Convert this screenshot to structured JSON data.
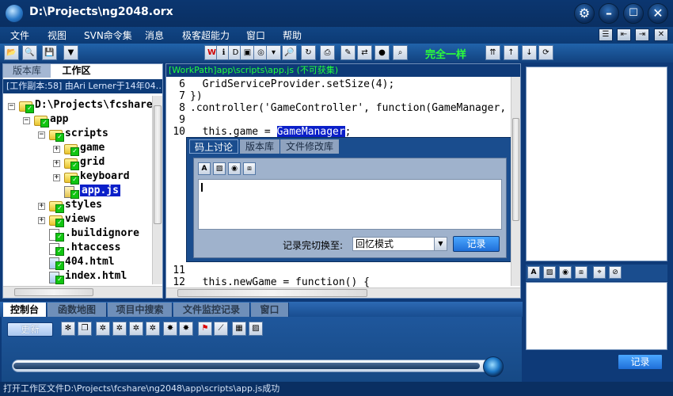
{
  "title": "D:\\Projects\\ng2048.orx",
  "menu": [
    "文件",
    "视图",
    "SVN命令集",
    "消息",
    "极客超能力",
    "窗口",
    "帮助"
  ],
  "toolbar": {
    "sync_status": "完全一样"
  },
  "left_panel": {
    "tabs": [
      "版本库",
      "工作区"
    ],
    "active_tab": "工作区",
    "workspace_info": "[工作副本:58] 由Ari Lerner于14年04…",
    "tree": [
      {
        "label": "D:\\Projects\\fcshare",
        "type": "folder",
        "expander": "−",
        "depth": 0
      },
      {
        "label": "app",
        "type": "folder",
        "expander": "−",
        "depth": 1
      },
      {
        "label": "scripts",
        "type": "folder",
        "expander": "−",
        "depth": 2
      },
      {
        "label": "game",
        "type": "folder",
        "expander": "+",
        "depth": 3
      },
      {
        "label": "grid",
        "type": "folder",
        "expander": "+",
        "depth": 3
      },
      {
        "label": "keyboard",
        "type": "folder",
        "expander": "+",
        "depth": 3
      },
      {
        "label": "app.js",
        "type": "js",
        "expander": "",
        "depth": 3,
        "selected": true
      },
      {
        "label": "styles",
        "type": "folder",
        "expander": "+",
        "depth": 2
      },
      {
        "label": "views",
        "type": "folder",
        "expander": "+",
        "depth": 2
      },
      {
        "label": ".buildignore",
        "type": "file",
        "expander": "",
        "depth": 2
      },
      {
        "label": ".htaccess",
        "type": "file",
        "expander": "",
        "depth": 2
      },
      {
        "label": "404.html",
        "type": "html",
        "expander": "",
        "depth": 2
      },
      {
        "label": "index.html",
        "type": "html",
        "expander": "",
        "depth": 2
      }
    ]
  },
  "editor": {
    "path": "[WorkPath]app\\scripts\\app.js (不可获集)",
    "lines": [
      {
        "num": "6",
        "text": "  GridServiceProvider.setSize(4);"
      },
      {
        "num": "7",
        "text": "})"
      },
      {
        "num": "8",
        "text": ".controller('GameController', function(GameManager,"
      },
      {
        "num": "9",
        "text": ""
      },
      {
        "num": "10",
        "pre": "  this.game = ",
        "sel": "GameManager",
        "post": ";"
      },
      {
        "num": "11",
        "text": ""
      },
      {
        "num": "12",
        "text": "  this.newGame = function() {"
      }
    ],
    "popup": {
      "tabs": [
        "码上讨论",
        "版本库",
        "文件修改库"
      ],
      "active_tab": "码上讨论",
      "switch_label": "记录完切换至:",
      "mode_value": "回忆模式",
      "record_button": "记录"
    }
  },
  "bottom_tabs": [
    "控制台",
    "函数地图",
    "项目中搜索",
    "文件监控记录",
    "窗口"
  ],
  "console": {
    "update_button": "更新",
    "slider_value": 0.98
  },
  "right_panel": {
    "record_button": "记录"
  },
  "status": "打开工作区文件D:\\Projects\\fcshare\\ng2048\\app\\scripts\\app.js成功"
}
